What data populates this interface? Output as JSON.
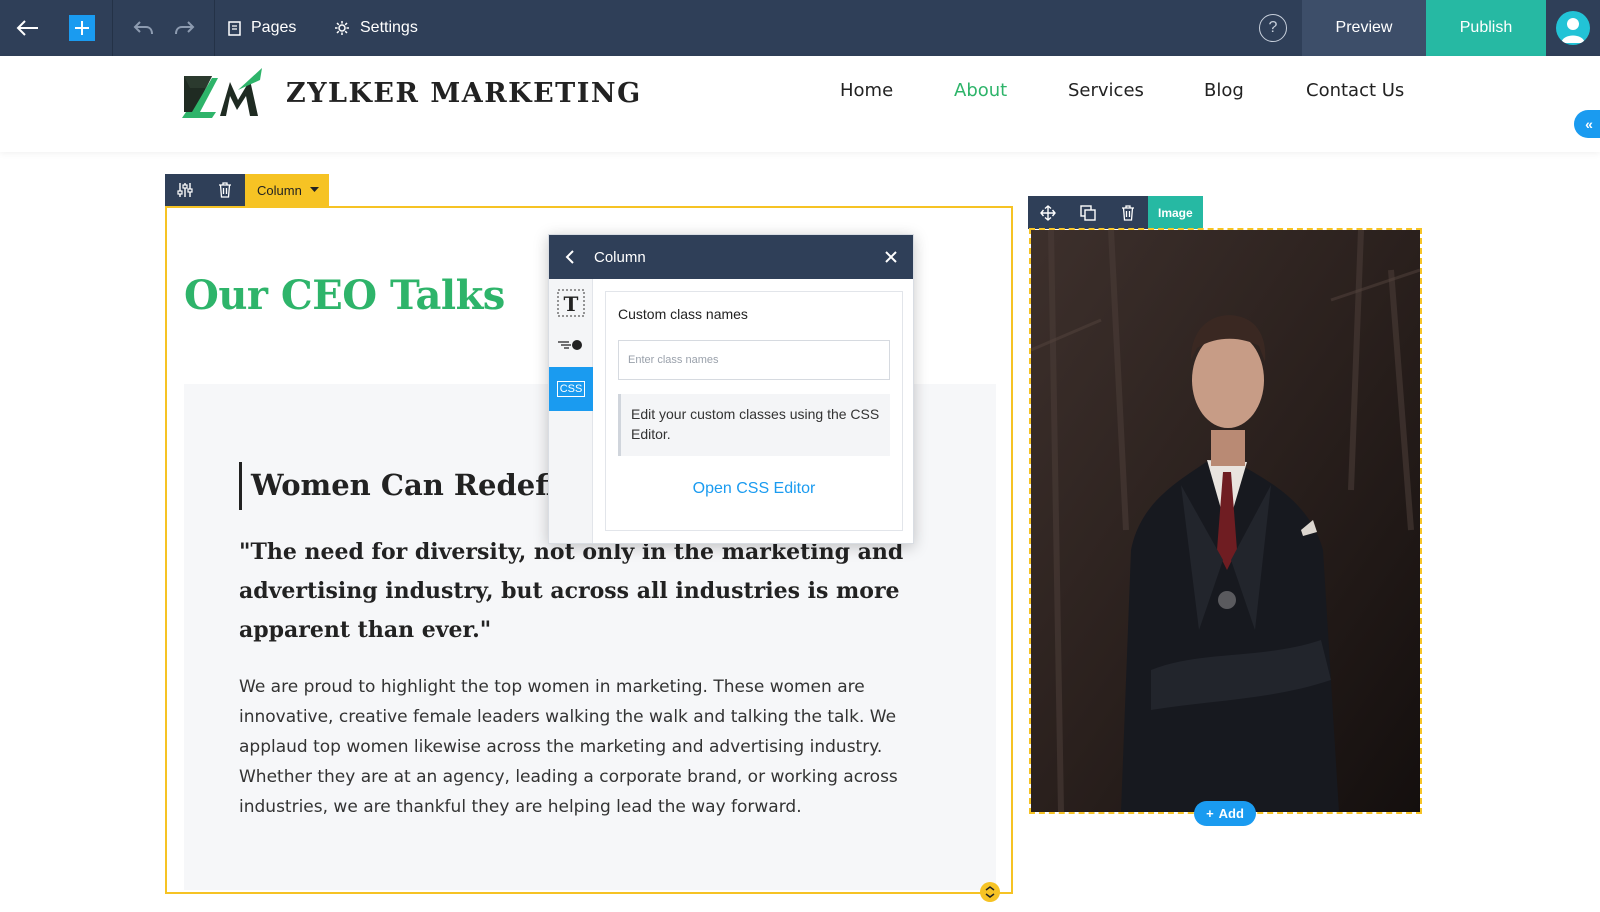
{
  "toolbar": {
    "pages_label": "Pages",
    "settings_label": "Settings",
    "help_label": "?",
    "preview_label": "Preview",
    "publish_label": "Publish",
    "icons": [
      "back-arrow-icon",
      "plus-icon",
      "undo-icon",
      "redo-icon",
      "page-icon",
      "gear-icon",
      "help-icon",
      "user-avatar-icon"
    ]
  },
  "site": {
    "brand": "ZYLKER MARKETING",
    "nav": [
      {
        "label": "Home",
        "active": false
      },
      {
        "label": "About",
        "active": true
      },
      {
        "label": "Services",
        "active": false
      },
      {
        "label": "Blog",
        "active": false
      },
      {
        "label": "Contact Us",
        "active": false
      }
    ]
  },
  "column_toolbar": {
    "label": "Column",
    "icons": [
      "sliders-icon",
      "trash-icon",
      "caret-down-icon"
    ]
  },
  "content": {
    "title": "Our CEO Talks",
    "subtitle": "Women Can Redefine",
    "quote": "\"The need for diversity, not only in the marketing and advertising industry, but across all industries is more apparent than ever.\"",
    "body": "We are proud to highlight the top women in marketing. These women are innovative, creative female leaders walking the walk and talking the talk. We applaud top women likewise across the marketing and advertising industry. Whether they are at an agency, leading a corporate brand, or working across industries, we are thankful they are helping lead the way forward."
  },
  "popup": {
    "title": "Column",
    "css_tab_label": "CSS",
    "text_tab_label": "T",
    "field_label": "Custom class names",
    "field_placeholder": "Enter class names",
    "field_value": "",
    "note": "Edit your custom classes using the CSS Editor.",
    "link_label": "Open CSS Editor"
  },
  "image_block": {
    "label": "Image",
    "add_label": "Add",
    "icons": [
      "move-icon",
      "duplicate-icon",
      "trash-icon"
    ]
  },
  "colors": {
    "toolbar_bg": "#2f3f58",
    "accent_blue": "#1a9bf0",
    "teal": "#26b9a3",
    "selection_yellow": "#f6c324",
    "brand_green": "#2eb46a"
  }
}
